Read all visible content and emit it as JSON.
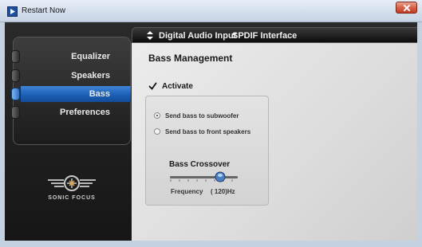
{
  "window": {
    "title": "Restart Now",
    "close_icon": "close-icon"
  },
  "sidebar": {
    "items": [
      {
        "label": "Equalizer",
        "active": false
      },
      {
        "label": "Speakers",
        "active": false
      },
      {
        "label": "Bass",
        "active": true
      },
      {
        "label": "Preferences",
        "active": false
      }
    ]
  },
  "logo": {
    "text": "SONIC FOCUS",
    "icon": "sonic-focus-logo"
  },
  "header": {
    "input_label": "Digital Audio Input",
    "spdif_label": "SPDIF Interface",
    "arrows_icon": "up-down-arrows-icon"
  },
  "bass": {
    "title": "Bass Management",
    "activate_label": "Activate",
    "activate_checked": true,
    "options": [
      {
        "label": "Send bass to subwoofer",
        "selected": true
      },
      {
        "label": "Send bass to front speakers",
        "selected": false
      }
    ],
    "crossover": {
      "title": "Bass Crossover",
      "frequency_label": "Frequency",
      "frequency_value": "( 120)Hz"
    }
  },
  "colors": {
    "active_nav": "#1c5fb6",
    "dark_bg": "#1c1c1c",
    "panel_bg": "#e0e0e0"
  }
}
